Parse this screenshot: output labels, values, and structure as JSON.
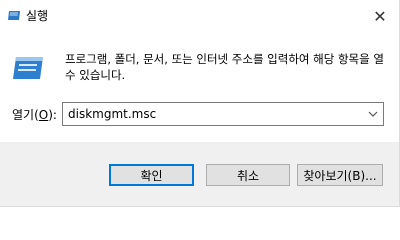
{
  "window": {
    "title": "실행",
    "close_glyph": "✕",
    "icon": "run-icon"
  },
  "content": {
    "description": "프로그램, 폴더, 문서, 또는 인터넷 주소를 입력하여 해당 항목을 열 수 있습니다.",
    "open_label_prefix": "열기(",
    "open_label_key": "O",
    "open_label_suffix": "):",
    "open_value": "diskmgmt.msc",
    "dropdown_glyph": "⌄"
  },
  "buttons": {
    "ok": "확인",
    "cancel": "취소",
    "browse": "찾아보기(B)..."
  },
  "colors": {
    "accent": "#0078d7",
    "footer_bg": "#f0f0f0",
    "button_bg": "#e1e1e1"
  }
}
